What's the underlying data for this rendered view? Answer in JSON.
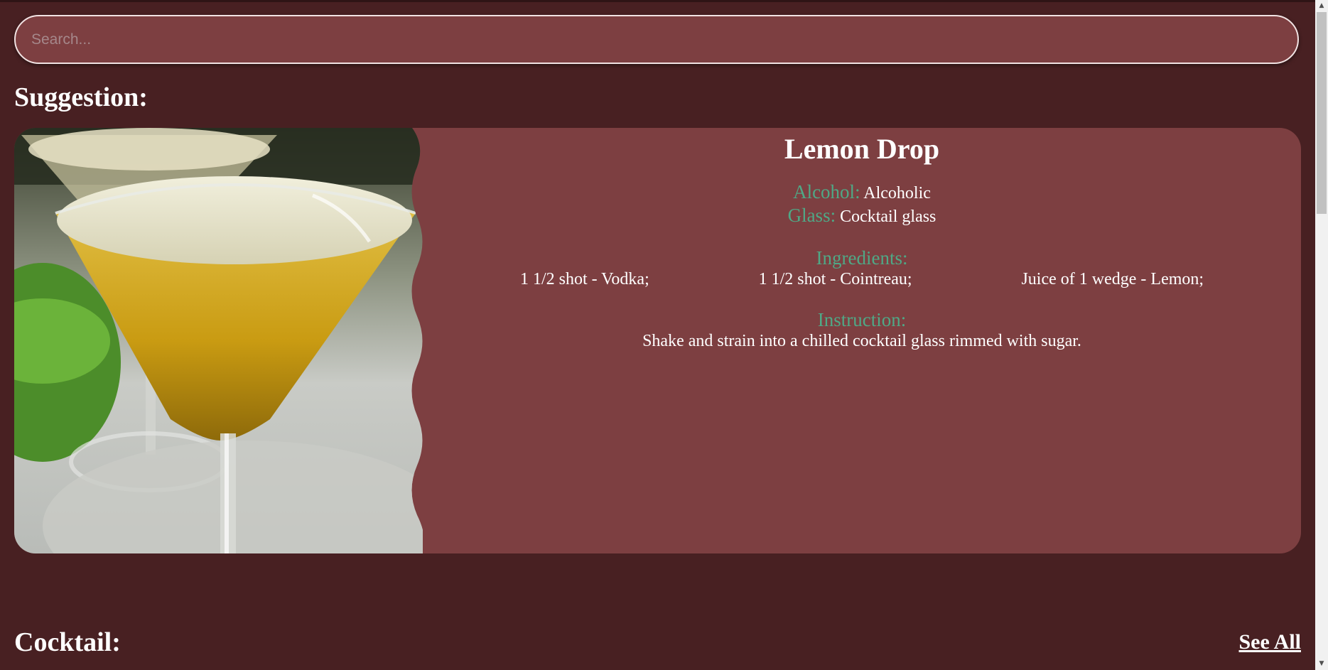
{
  "search": {
    "placeholder": "Search...",
    "value": ""
  },
  "suggestion": {
    "heading": "Suggestion:",
    "drink": {
      "name": "Lemon Drop",
      "alcohol_label": "Alcohol:",
      "alcohol_value": "Alcoholic",
      "glass_label": "Glass:",
      "glass_value": "Cocktail glass",
      "ingredients_label": "Ingredients:",
      "ingredients": [
        "1 1/2 shot - Vodka;",
        "1 1/2 shot - Cointreau;",
        "Juice of 1 wedge - Lemon;"
      ],
      "instruction_label": "Instruction:",
      "instruction": "Shake and strain into a chilled cocktail glass rimmed with sugar.",
      "image_icon": "cocktail-photo"
    }
  },
  "cocktail": {
    "heading": "Cocktail:",
    "see_all": "See All"
  },
  "scrollbar": {
    "up_arrow": "▲",
    "down_arrow": "▼"
  },
  "colors": {
    "background": "#482022",
    "card": "#7d3f41",
    "label_accent": "#4fa886",
    "text": "#ffffff"
  }
}
